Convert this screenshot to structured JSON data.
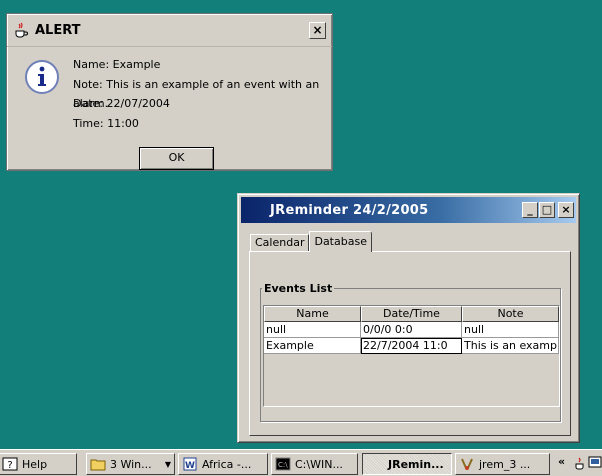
{
  "alert": {
    "title": "ALERT",
    "close_label": "×",
    "lines": [
      "Name: Example",
      "Note: This is an example of an event with an alarm.",
      "Date: 22/07/2004",
      "Time: 11:00"
    ],
    "ok_label": "OK"
  },
  "jreminder": {
    "title": "JReminder 24/2/2005",
    "minimize_label": "_",
    "maximize_label": "□",
    "close_label": "×",
    "tabs": [
      {
        "label": "Calendar",
        "active": false
      },
      {
        "label": "Database",
        "active": true
      }
    ],
    "events_list": {
      "legend": "Events List",
      "columns": [
        "Name",
        "Date/Time",
        "Note"
      ],
      "rows": [
        [
          "null",
          "0/0/0 0:0",
          "null"
        ],
        [
          "Example",
          "22/7/2004 11:0",
          "This is an exampl..."
        ]
      ]
    }
  },
  "taskbar": {
    "items": [
      {
        "label": "Help",
        "icon": "help-icon"
      },
      {
        "label": "3 Win...",
        "icon": "folder-icon"
      },
      {
        "label": "Africa -...",
        "icon": "word-document-icon"
      },
      {
        "label": "C:\\WIN...",
        "icon": "command-prompt-icon"
      },
      {
        "label": "JRemin...",
        "icon": "java-icon"
      },
      {
        "label": "jrem_3 ...",
        "icon": "paint-icon"
      }
    ],
    "tray_arrows": "«"
  },
  "colors": {
    "desktop": "#137f7b",
    "title_active_start": "#0a246a",
    "title_active_end": "#a6caf0",
    "face": "#d4d0c8"
  }
}
